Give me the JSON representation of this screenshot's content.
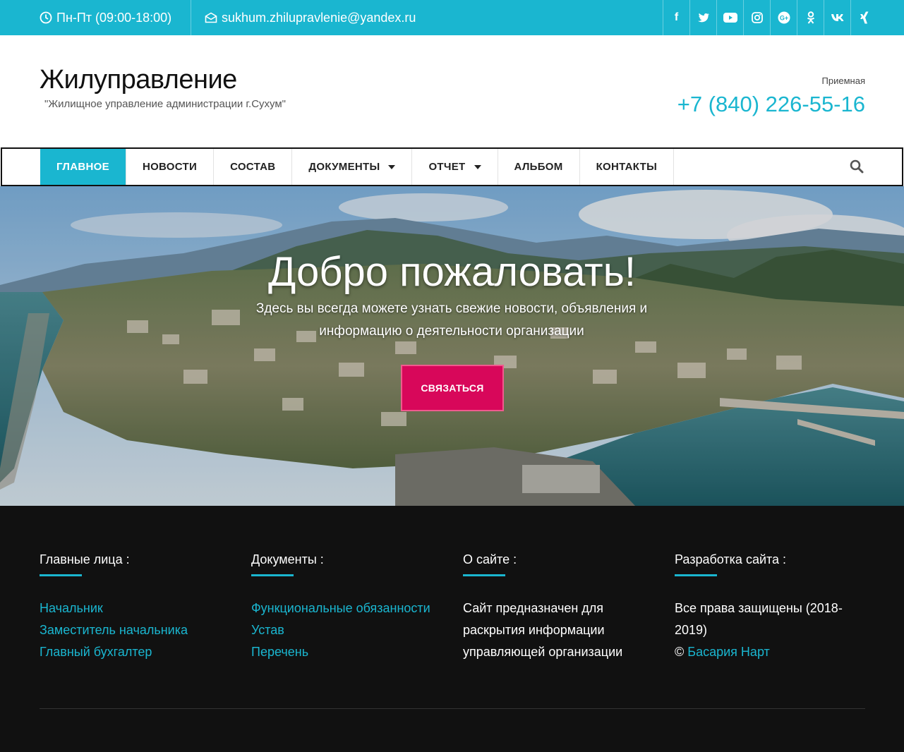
{
  "topbar": {
    "hours": "Пн-Пт (09:00-18:00)",
    "email": "sukhum.zhilupravlenie@yandex.ru",
    "socials": [
      "facebook-icon",
      "twitter-icon",
      "youtube-icon",
      "instagram-icon",
      "google-plus-icon",
      "odnoklassniki-icon",
      "vk-icon",
      "xing-icon"
    ],
    "accent": "#1ab6d0"
  },
  "header": {
    "site_name": "Жилуправление",
    "tagline": "\"Жилищное управление администрации г.Сухум\"",
    "contact_label": "Приемная",
    "phone": "+7 (840) 226-55-16"
  },
  "nav": {
    "items": [
      {
        "label": "ГЛАВНОЕ",
        "active": true
      },
      {
        "label": "НОВОСТИ"
      },
      {
        "label": "СОСТАВ"
      },
      {
        "label": "ДОКУМЕНТЫ",
        "dropdown": true
      },
      {
        "label": "ОТЧЕТ",
        "dropdown": true
      },
      {
        "label": "АЛЬБОМ"
      },
      {
        "label": "КОНТАКТЫ"
      }
    ]
  },
  "hero": {
    "title": "Добро пожаловать!",
    "subtitle": "Здесь вы всегда можете узнать свежие новости, объявления и информацию о деятельности организации",
    "button": "СВЯЗАТЬСЯ",
    "button_color": "#d8075a"
  },
  "footer": {
    "col1": {
      "title": "Главные лица :",
      "links": [
        "Начальник",
        "Заместитель начальника",
        "Главный бухгалтер"
      ]
    },
    "col2": {
      "title": "Документы :",
      "links": [
        "Функциональные обязанности",
        "Устав",
        "Перечень"
      ]
    },
    "col3": {
      "title": "О сайте :",
      "text": "Сайт предназначен для раскрытия информации управляющей организации"
    },
    "col4": {
      "title": "Разработка сайта :",
      "text": "Все права защищены (2018-2019)",
      "copyright": "©",
      "author": "Басария Нарт"
    }
  }
}
